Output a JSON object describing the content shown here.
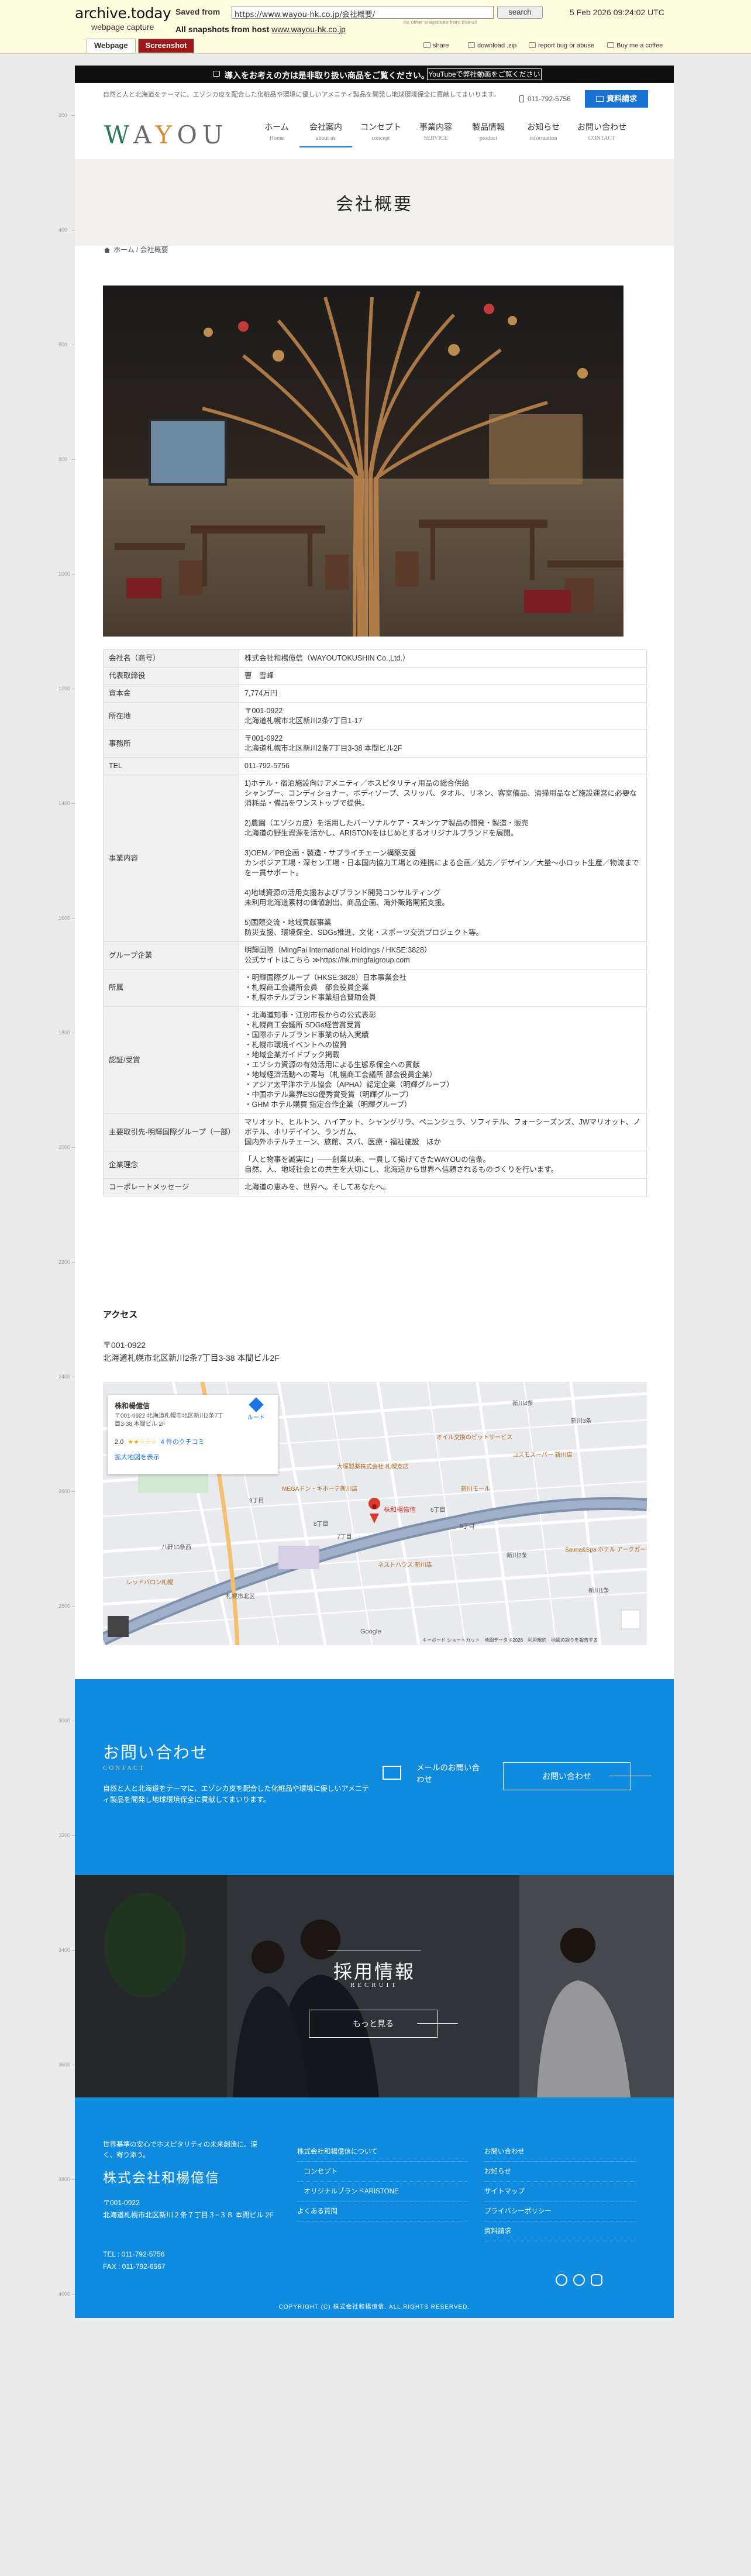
{
  "archive": {
    "logo": "archive.today",
    "subtitle": "webpage capture",
    "saved_from_label": "Saved from",
    "url": "https://www.wayou-hk.co.jp/会社概要/",
    "search_label": "search",
    "date": "5 Feb 2026 09:24:02 UTC",
    "no_other": "no other snapshots from this url",
    "host_label": "All snapshots from host",
    "host": "www.wayou-hk.co.jp",
    "tab_webpage": "Webpage",
    "tab_screenshot": "Screenshot",
    "share": "share",
    "download": "download .zip",
    "report": "report bug or abuse",
    "coffee": "Buy me a coffee"
  },
  "timeline": {
    "labels": [
      "200",
      "400",
      "600",
      "800",
      "1000",
      "1200",
      "1400",
      "1600",
      "1800",
      "2000",
      "2200",
      "2400",
      "2600",
      "2800",
      "3000",
      "3200",
      "3400",
      "3600",
      "3800",
      "4000"
    ]
  },
  "site": {
    "notice": "導入をお考えの方は是非取り扱い商品をご覧ください。",
    "notice_button": "YouTubeで弊社動画をご覧ください",
    "tagline": "自然と人と北海道をテーマに、エゾシカ皮を配合した化粧品や環境に優しいアメニティ製品を開発し地球環境保全に貢献してまいります。",
    "tel": "011-792-5756",
    "request_button": "資料請求",
    "logo": "WAYOU",
    "nav": [
      {
        "jp": "ホーム",
        "en": "Home"
      },
      {
        "jp": "会社案内",
        "en": "about us"
      },
      {
        "jp": "コンセプト",
        "en": "concept"
      },
      {
        "jp": "事業内容",
        "en": "SERVICE"
      },
      {
        "jp": "製品情報",
        "en": "product"
      },
      {
        "jp": "お知らせ",
        "en": "information"
      },
      {
        "jp": "お問い合わせ",
        "en": "CONTACT"
      }
    ],
    "page_title": "会社概要",
    "breadcrumb": {
      "home": "ホーム",
      "sep": "/",
      "current": "会社概要"
    }
  },
  "company_table": [
    {
      "label": "会社名（商号）",
      "value": "株式会社和楊億信（WAYOUTOKUSHIN Co.,Ltd.）"
    },
    {
      "label": "代表取締役",
      "value": "曹　雪峰"
    },
    {
      "label": "資本金",
      "value": "7,774万円"
    },
    {
      "label": "所在地",
      "value": "〒001-0922\n北海道札幌市北区新川2条7丁目1-17"
    },
    {
      "label": "事務所",
      "value": "〒001-0922\n北海道札幌市北区新川2条7丁目3-38 本間ビル2F"
    },
    {
      "label": "TEL",
      "value": "011-792-5756"
    },
    {
      "label": "事業内容",
      "value": "1)ホテル・宿泊施設向けアメニティ／ホスピタリティ用品の総合供給\nシャンプー、コンディショナー、ボディソープ、スリッパ、タオル、リネン、客室備品、清掃用品など施設運営に必要な消耗品・備品をワンストップで提供。\n\n2)農園（エゾシカ皮）を活用したパーソナルケア・スキンケア製品の開発・製造・販売\n北海道の野生資源を活かし、ARISTONをはじめとするオリジナルブランドを展開。\n\n3)OEM／PB企画・製造・サプライチェーン構築支援\nカンボジア工場・深セン工場・日本国内協力工場との連携による企画／処方／デザイン／大量〜小ロット生産／物流までを一貫サポート。\n\n4)地域資源の活用支援およびブランド開発コンサルティング\n未利用北海道素材の価値創出、商品企画、海外販路開拓支援。\n\n5)国際交流・地域貢献事業\n防災支援、環境保全、SDGs推進、文化・スポーツ交流プロジェクト等。"
    },
    {
      "label": "グループ企業",
      "value": "明輝国際（MingFai International Holdings / HKSE:3828）\n公式サイトはこちら ≫https://hk.mingfaigroup.com"
    },
    {
      "label": "所属",
      "value": "・明輝国際グループ（HKSE:3828）日本事業会社\n・札幌商工会議所会員　部会役員企業\n・札幌ホテルブランド事業組合賛助会員"
    },
    {
      "label": "認証/受賞",
      "value": "・北海道知事・江別市長からの公式表彰\n・札幌商工会議所 SDGs経営賞受賞\n・国際ホテルブランド事業の納入実績\n・札幌市環境イベントへの協賛\n・地域企業ガイドブック掲載\n・エゾシカ資源の有効活用による生態系保全への貢献\n・地域経済活動への寄与（札幌商工会議所 部会役員企業）\n・アジア太平洋ホテル協会（APHA）認定企業（明輝グループ）\n・中国ホテル業界ESG優秀賞受賞（明輝グループ）\n・GHM ホテル購買 指定合作企業（明輝グループ）"
    },
    {
      "label": "主要取引先-明輝国際グループ（一部）",
      "value": "マリオット、ヒルトン、ハイアット、シャングリラ、ペニンシュラ、ソフィテル、フォーシーズンズ、JWマリオット、ノボテル、ホリデイイン、ランガム、\n国内外ホテルチェーン、旅館、スパ、医療・福祉施設　ほか"
    },
    {
      "label": "企業理念",
      "value": "「人と物事を誠実に」――創業以来、一貫して掲げてきたWAYOUの信条。\n自然、人、地域社会との共生を大切にし、北海道から世界へ信頼されるものづくりを行います。"
    },
    {
      "label": "コーポレートメッセージ",
      "value": "北海道の恵みを、世界へ。そしてあなたへ。"
    }
  ],
  "access": {
    "heading": "アクセス",
    "address": "〒001-0922\n北海道札幌市北区新川2条7丁目3-38 本間ビル2F"
  },
  "map": {
    "card_title": "株和楊億信",
    "card_address": "〒001-0922 北海道札幌市北区新川2条7丁目3-38 本間ビル 2F",
    "route": "ルート",
    "rating": "2.0",
    "reviews": "4 件のクチコミ",
    "enlarge": "拡大地図を表示",
    "pin_label": "株和楊億信",
    "places": [
      "大塚製薬株式会社 札幌支店",
      "MEGAドン・キホーテ新川店",
      "新川モール",
      "オイル交換のピットサービス",
      "コスモスーパー 新川店",
      "レッドバロン札幌",
      "ネストハウス 新川店",
      "Sauna&Spa ホテル アークガーデン"
    ],
    "streets": [
      "新川3条",
      "新川4条",
      "新川1条",
      "新川2条",
      "8丁目",
      "7丁目",
      "6丁目",
      "9丁目",
      "5丁目",
      "八軒10条西",
      "札幌市北区"
    ],
    "footer": "キーボード ショートカット　地図データ ©2026　利用規約　地図の誤りを報告する",
    "google": "Google"
  },
  "contact": {
    "title": "お問い合わせ",
    "subtitle": "CONTACT",
    "desc": "自然と人と北海道をテーマに、エゾシカ皮を配合した化粧品や環境に優しいアメニティ製品を開発し地球環境保全に貢献してまいります。",
    "mail_label": "メールのお問い合わせ",
    "button": "お問い合わせ"
  },
  "recruit": {
    "title": "採用情報",
    "subtitle": "RECRUIT",
    "button": "もっと見る"
  },
  "footer": {
    "message": "世界基準の安心でホスピタリティの未来創造に。深く、寄り添う。",
    "company": "株式会社和楊億信",
    "address": "〒001-0922\n北海道札幌市北区新川２条７丁目３−３８ 本間ビル 2F",
    "tel": "TEL : 011-792-5756",
    "fax": "FAX : 011-792-6567",
    "col1": [
      "株式会社和楊億信について",
      "　コンセプト",
      "　オリジナルブランドARISTONE",
      "よくある質問"
    ],
    "col2": [
      "お問い合わせ",
      "お知らせ",
      "サイトマップ",
      "プライバシーポリシー",
      "資料請求"
    ],
    "copyright": "COPYRIGHT (C) 株式会社和楊億信. ALL RIGHTS RESERVED."
  },
  "colors": {
    "brand_blue": "#0f8ce0",
    "accent_blue": "#1872d4",
    "archive_red": "#9e1a1a",
    "logo_green": "#2a7a5a",
    "logo_orange": "#d98a2a"
  }
}
